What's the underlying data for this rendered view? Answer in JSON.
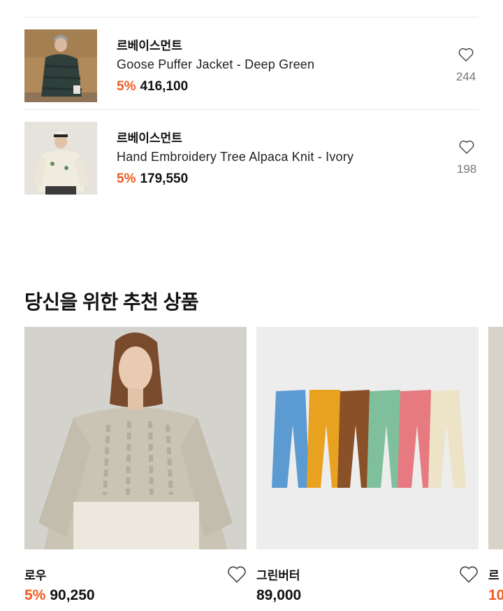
{
  "recent_products": [
    {
      "brand": "르베이스먼트",
      "name": "Goose Puffer Jacket - Deep Green",
      "discount": "5%",
      "price": "416,100",
      "likes": "244"
    },
    {
      "brand": "르베이스먼트",
      "name": "Hand Embroidery Tree Alpaca Knit - Ivory",
      "discount": "5%",
      "price": "179,550",
      "likes": "198"
    }
  ],
  "recommend": {
    "title": "당신을 위한 추천 상품",
    "cards": [
      {
        "brand": "로우",
        "discount": "5%",
        "price": "90,250"
      },
      {
        "brand": "그린버터",
        "discount": "",
        "price": "89,000"
      },
      {
        "brand": "르",
        "discount": "10",
        "price": ""
      }
    ]
  },
  "colors": {
    "discount": "#f05a22",
    "divider": "#e6e6e6"
  }
}
